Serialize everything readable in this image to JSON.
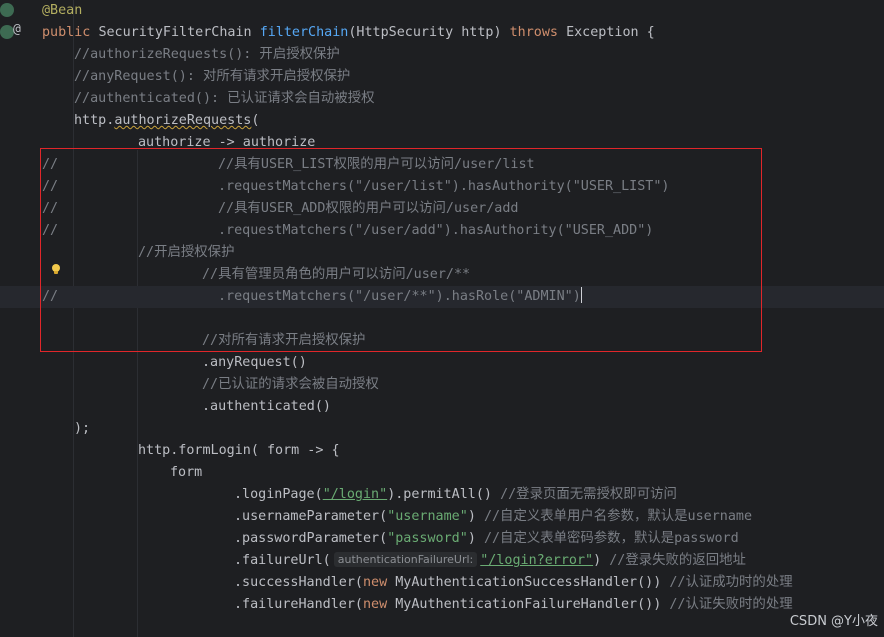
{
  "editor": {
    "lines": [
      {
        "annotation": "@Bean"
      },
      {
        "kw_public": "public",
        "type": "SecurityFilterChain",
        "method": "filterChain",
        "params": "(HttpSecurity http)",
        "kw_throws": "throws",
        "rest": "Exception {"
      },
      {
        "comment": "//authorizeRequests(): 开启授权保护"
      },
      {
        "comment": "//anyRequest(): 对所有请求开启授权保护"
      },
      {
        "comment": "//authenticated(): 已认证请求会自动被授权"
      },
      {
        "pre": "http.",
        "method": "authorizeRequests",
        "post": "("
      },
      {
        "code": "authorize -> authorize"
      },
      {
        "marker": "//",
        "comment": "//具有USER_LIST权限的用户可以访问/user/list"
      },
      {
        "marker": "//",
        "code": ".requestMatchers(\"/user/list\").hasAuthority(\"USER_LIST\")"
      },
      {
        "marker": "//",
        "comment": "//具有USER_ADD权限的用户可以访问/user/add"
      },
      {
        "marker": "//",
        "code": ".requestMatchers(\"/user/add\").hasAuthority(\"USER_ADD\")"
      },
      {
        "comment": "//开启授权保护"
      },
      {
        "comment": "//具有管理员角色的用户可以访问/user/**"
      },
      {
        "marker": "//",
        "code": ".requestMatchers(\"/user/**\").hasRole(\"ADMIN\")"
      },
      {
        "code": ""
      },
      {
        "comment": "//对所有请求开启授权保护"
      },
      {
        "code": ".anyRequest()"
      },
      {
        "comment": "//已认证的请求会被自动授权"
      },
      {
        "code": ".authenticated()"
      },
      {
        "code": ");"
      },
      {
        "code": "http.formLogin( form -> {"
      },
      {
        "code": "form"
      },
      {
        "pre": ".loginPage(",
        "str": "\"/login\"",
        "post": ").permitAll()",
        "comment": "//登录页面无需授权即可访问"
      },
      {
        "pre": ".usernameParameter(",
        "str": "\"username\"",
        "post": ")",
        "comment": "//自定义表单用户名参数，默认是username"
      },
      {
        "pre": ".passwordParameter(",
        "str": "\"password\"",
        "post": ")",
        "comment": "//自定义表单密码参数，默认是password"
      },
      {
        "pre": ".failureUrl(",
        "hint": "authenticationFailureUrl:",
        "str": "\"/login?error\"",
        "post": ")",
        "comment": "//登录失败的返回地址"
      },
      {
        "pre": ".successHandler(",
        "kw": "new",
        "type": "MyAuthenticationSuccessHandler",
        "post": "())",
        "comment": "//认证成功时的处理"
      },
      {
        "pre": ".failureHandler(",
        "kw": "new",
        "type": "MyAuthenticationFailureHandler",
        "post": "())",
        "comment": "//认证失败时的处理"
      }
    ]
  },
  "gutter": {
    "icon1": "bean-icon",
    "icon2": "@"
  },
  "watermark": "CSDN @Y小夜",
  "colors": {
    "background": "#1e1f22",
    "keyword": "#cf8e6d",
    "method": "#56a8f5",
    "string": "#6aab73",
    "comment": "#7a7e85",
    "annotation": "#b3ae60",
    "highlight": "#e0262a"
  }
}
